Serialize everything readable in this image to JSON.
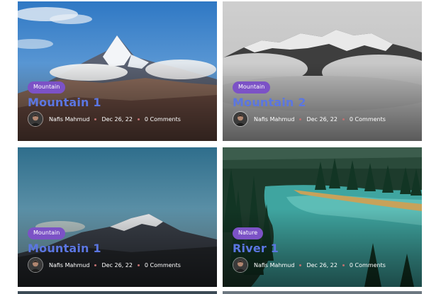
{
  "posts": [
    {
      "category": "Mountain",
      "title": "Mountain 1",
      "author": "Nafis Mahmud",
      "date": "Dec 26, 22",
      "comments": "0 Comments"
    },
    {
      "category": "Mountain",
      "title": "Mountain 2",
      "author": "Nafis Mahmud",
      "date": "Dec 26, 22",
      "comments": "0 Comments"
    },
    {
      "category": "Mountain",
      "title": "Mountain 1",
      "author": "Nafis Mahmud",
      "date": "Dec 26, 22",
      "comments": "0 Comments"
    },
    {
      "category": "Nature",
      "title": "River 1",
      "author": "Nafis Mahmud",
      "date": "Dec 26, 22",
      "comments": "0 Comments"
    }
  ],
  "colors": {
    "badge": "#7c52c6",
    "title": "#5b76e2",
    "meta_dot": "#c07070"
  }
}
